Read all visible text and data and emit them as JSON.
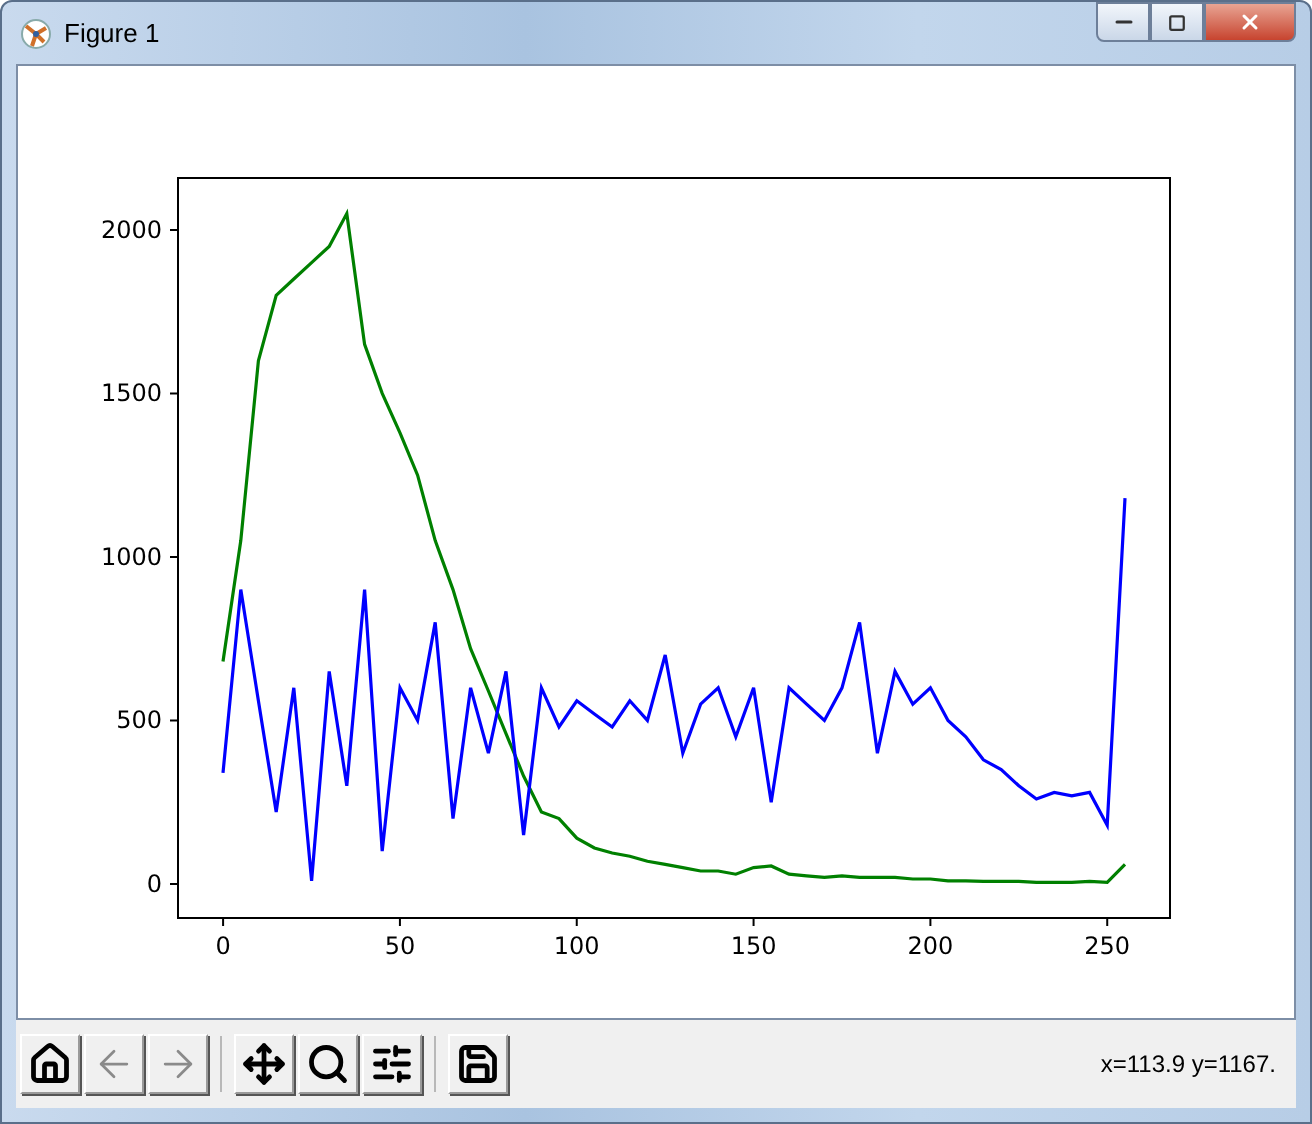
{
  "window": {
    "title": "Figure 1",
    "controls": [
      {
        "kind": "minimize"
      },
      {
        "kind": "maximize"
      },
      {
        "kind": "close"
      }
    ]
  },
  "chart_data": {
    "type": "line",
    "xlim": [
      -12.75,
      267.75
    ],
    "ylim": [
      -104,
      2159
    ],
    "xticks": [
      0,
      50,
      100,
      150,
      200,
      250
    ],
    "yticks": [
      0,
      500,
      1000,
      1500,
      2000
    ],
    "x": [
      0,
      5,
      10,
      15,
      20,
      25,
      30,
      35,
      40,
      45,
      50,
      55,
      60,
      65,
      70,
      75,
      80,
      85,
      90,
      95,
      100,
      105,
      110,
      115,
      120,
      125,
      130,
      135,
      140,
      145,
      150,
      155,
      160,
      165,
      170,
      175,
      180,
      185,
      190,
      195,
      200,
      205,
      210,
      215,
      220,
      225,
      230,
      235,
      240,
      245,
      250,
      255
    ],
    "series": [
      {
        "color": "#008000",
        "values": [
          680,
          1050,
          1600,
          1800,
          1850,
          1900,
          1950,
          2050,
          1650,
          1500,
          1380,
          1250,
          1050,
          900,
          720,
          590,
          460,
          330,
          220,
          200,
          140,
          110,
          95,
          85,
          70,
          60,
          50,
          40,
          40,
          30,
          50,
          55,
          30,
          25,
          20,
          25,
          20,
          20,
          20,
          15,
          15,
          10,
          10,
          8,
          8,
          8,
          5,
          5,
          5,
          8,
          5,
          60
        ]
      },
      {
        "color": "#0000ff",
        "values": [
          340,
          900,
          560,
          220,
          600,
          10,
          650,
          300,
          900,
          100,
          600,
          500,
          800,
          200,
          600,
          400,
          650,
          150,
          600,
          480,
          560,
          520,
          480,
          560,
          500,
          700,
          400,
          550,
          600,
          450,
          600,
          250,
          600,
          550,
          500,
          600,
          800,
          400,
          650,
          550,
          600,
          500,
          450,
          380,
          350,
          300,
          260,
          280,
          270,
          280,
          180,
          1180
        ]
      }
    ]
  },
  "toolbar": {
    "buttons": [
      {
        "kind": "home",
        "disabled": false
      },
      {
        "kind": "back",
        "disabled": true
      },
      {
        "kind": "forward",
        "disabled": true
      },
      {
        "kind": "pan",
        "disabled": false
      },
      {
        "kind": "zoom",
        "disabled": false
      },
      {
        "kind": "configure",
        "disabled": false
      },
      {
        "kind": "save",
        "disabled": false
      }
    ],
    "status": "x=113.9 y=1167."
  }
}
